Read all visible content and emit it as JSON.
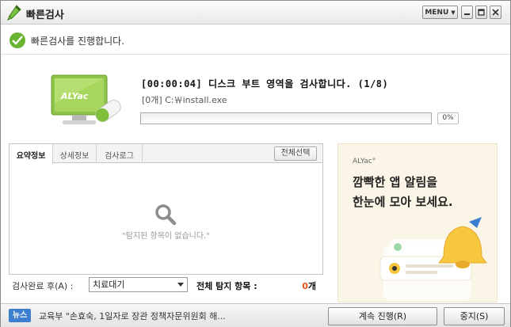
{
  "window": {
    "title": "빠른검사",
    "menu_label": "MENU",
    "app_icon": "pencil-icon",
    "minimize_icon": "minimize-icon",
    "maximize_icon": "maximize-icon",
    "close_icon": "close-icon"
  },
  "status": {
    "icon": "checkmark-icon",
    "text": "빠른검사를 진행합니다."
  },
  "scan": {
    "title": "[00:00:04] 디스크 부트 영역을 검사합니다. (1/8)",
    "current_path": "[0개] C:￦install.exe",
    "progress_value": 0,
    "progress_text": "0%",
    "logo_text": "ALYac",
    "accent_color": "#69b532"
  },
  "panel": {
    "tabs": [
      {
        "label": "요약정보",
        "active": true
      },
      {
        "label": "상세정보",
        "active": false
      },
      {
        "label": "검사로그",
        "active": false
      }
    ],
    "select_all_label": "전체선택",
    "empty_icon": "magnifier-icon",
    "empty_text": "\"탐지된 항목이 없습니다.\""
  },
  "after_scan": {
    "label": "검사완료 후(A) :",
    "selected_option": "치료대기",
    "total_label": "전체 탐지 항목 :",
    "total_count": "0",
    "total_unit": "개",
    "count_color": "#e8541e"
  },
  "ad": {
    "brand": "ALYac°",
    "line1": "깜빡한 앱 알림을",
    "line2": "한눈에 모아 보세요.",
    "art_icon": "bell-icon"
  },
  "bottom": {
    "news_badge": "뉴스",
    "news_text": "교육부 \"손효숙, 1일자로 장관 정책자문위원회 해...",
    "continue_label": "계속 진행(R)",
    "stop_label": "중지(S)"
  }
}
